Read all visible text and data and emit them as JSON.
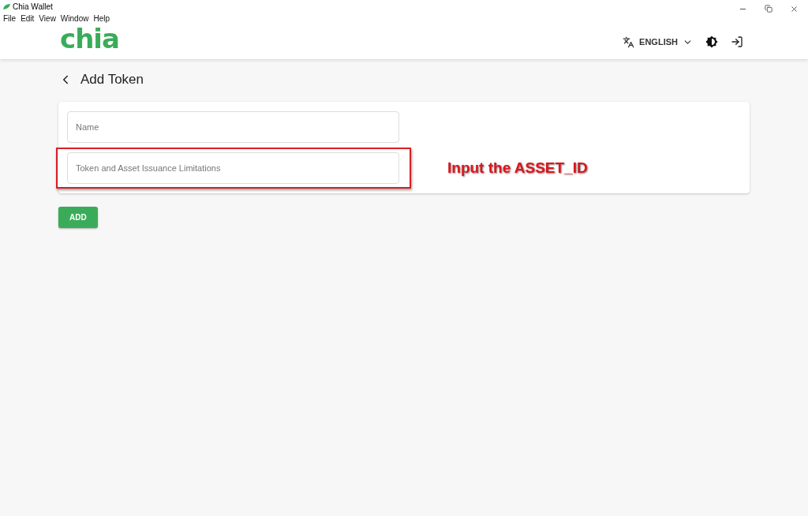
{
  "window": {
    "title": "Chia Wallet"
  },
  "menu": [
    "File",
    "Edit",
    "View",
    "Window",
    "Help"
  ],
  "header": {
    "logo": "chia",
    "language": "ENGLISH"
  },
  "page": {
    "title": "Add Token"
  },
  "fields": [
    {
      "placeholder": "Name",
      "highlighted": false
    },
    {
      "placeholder": "Token and Asset Issuance Limitations",
      "highlighted": true
    }
  ],
  "annotation": "Input the ASSET_ID",
  "buttons": [
    "ADD"
  ]
}
